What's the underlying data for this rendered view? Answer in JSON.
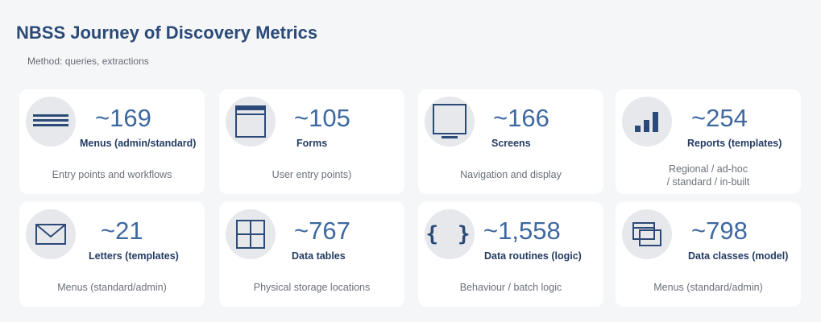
{
  "header": {
    "title": "NBSS Journey of Discovery Metrics",
    "subtitle": "Method: queries, extractions"
  },
  "cards": [
    {
      "icon": "menu-lines-icon",
      "value": "~169",
      "label": "Menus (admin/standard)",
      "desc": "Entry points and workflows"
    },
    {
      "icon": "form-window-icon",
      "value": "~105",
      "label": "Forms",
      "desc": "User entry points)"
    },
    {
      "icon": "monitor-icon",
      "value": "~166",
      "label": "Screens",
      "desc": "Navigation and display"
    },
    {
      "icon": "bar-chart-icon",
      "value": "~254",
      "label": "Reports (templates)",
      "desc1": "Regional / ad-hoc",
      "desc2": "/ standard / in-built"
    },
    {
      "icon": "envelope-icon",
      "value": "~21",
      "label": "Letters (templates)",
      "desc": "Menus (standard/admin)"
    },
    {
      "icon": "table-grid-icon",
      "value": "~767",
      "label": "Data tables",
      "desc": "Physical storage locations"
    },
    {
      "icon": "curly-braces-icon",
      "value": "~1,558",
      "label": "Data routines (logic)",
      "desc": "Behaviour / batch logic",
      "braces": "{ }"
    },
    {
      "icon": "class-boxes-icon",
      "value": "~798",
      "label": "Data classes (model)",
      "desc": "Menus (standard/admin)"
    }
  ],
  "colors": {
    "accent": "#3e68a0",
    "label": "#243b63",
    "icon": "#2c4a77",
    "circle": "#e6e8ec"
  }
}
